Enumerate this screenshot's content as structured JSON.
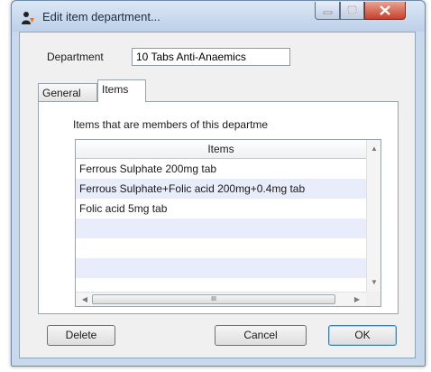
{
  "window": {
    "title": "Edit item department...",
    "icon": "user-silhouette-icon"
  },
  "form": {
    "department_label": "Department",
    "department_value": "10 Tabs Anti-Anaemics"
  },
  "tabs": [
    {
      "label": "General",
      "selected": false
    },
    {
      "label": "Items",
      "selected": true
    }
  ],
  "items_panel": {
    "caption": "Items that are members of this departme",
    "column_header": "Items",
    "rows": [
      "Ferrous Sulphate 200mg tab",
      "Ferrous Sulphate+Folic acid 200mg+0.4mg tab",
      "Folic acid 5mg tab",
      "",
      "",
      ""
    ],
    "scroll_thumb_grip": "III"
  },
  "buttons": {
    "delete": "Delete",
    "cancel": "Cancel",
    "ok": "OK"
  }
}
